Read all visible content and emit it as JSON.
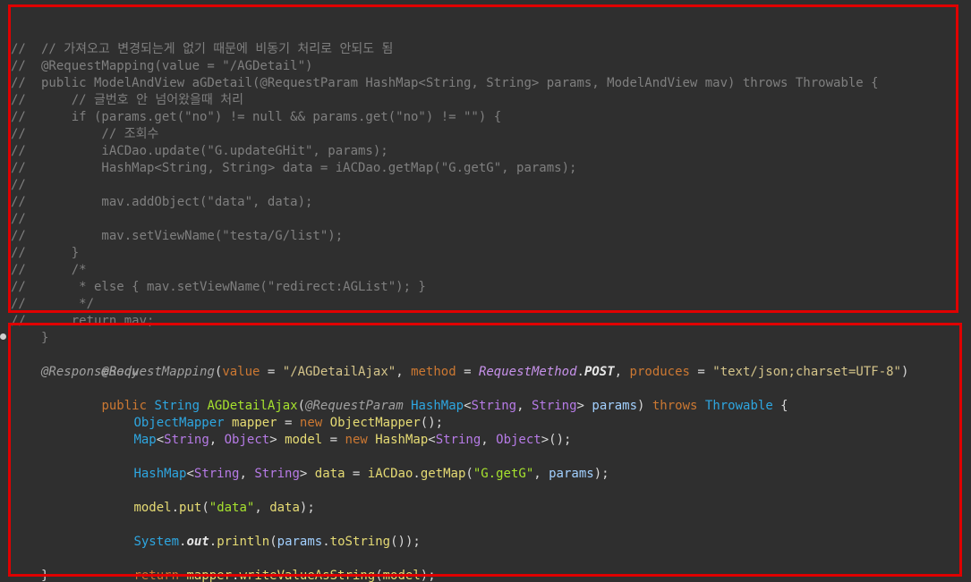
{
  "commented_block": {
    "lines": [
      "// 가져오고 변경되는게 없기 때문에 비동기 처리로 안되도 됨",
      "@RequestMapping(value = \"/AGDetail\")",
      "public ModelAndView aGDetail(@RequestParam HashMap<String, String> params, ModelAndView mav) throws Throwable {",
      "    // 글번호 안 넘어왔을때 처리",
      "    if (params.get(\"no\") != null && params.get(\"no\") != \"\") {",
      "        // 조회수",
      "        iACDao.update(\"G.updateGHit\", params);",
      "        HashMap<String, String> data = iACDao.getMap(\"G.getG\", params);",
      "",
      "        mav.addObject(\"data\", data);",
      "",
      "        mav.setViewName(\"testa/G/list\");",
      "    }",
      "    /*",
      "     * else { mav.setViewName(\"redirect:AGList\"); }",
      "     */",
      "    return mav;",
      "}"
    ],
    "margin_marks": [
      "",
      "//",
      "//",
      "//",
      "//",
      "//",
      "//",
      "//",
      "//",
      "//",
      "//",
      "//",
      "//",
      "//",
      "//",
      "//",
      "//",
      "//"
    ]
  },
  "active_block": {
    "line1": {
      "annotation": "@RequestMapping",
      "open": "(",
      "param1": "value",
      "eq1": " = ",
      "val1": "\"/AGDetailAjax\"",
      "comma1": ", ",
      "param2": "method",
      "eq2": " = ",
      "enum_type": "RequestMethod",
      "dot": ".",
      "enum_val": "POST",
      "comma2": ", ",
      "param3": "produces",
      "eq3": " = ",
      "val3": "\"text/json;charset=UTF-8\"",
      "close": ")"
    },
    "line2": "@ResponseBody",
    "line3": {
      "kw_public": "public",
      "sp1": " ",
      "type_string": "String",
      "sp2": " ",
      "method_name": "AGDetailAjax",
      "paren_open": "(",
      "param_annotation": "@RequestParam",
      "sp3": " ",
      "type_hashmap": "HashMap",
      "lt": "<",
      "type_s1": "String",
      "comma": ", ",
      "type_s2": "String",
      "gt": ">",
      "sp4": " ",
      "param_name": "params",
      "paren_close": ")",
      "sp5": " ",
      "kw_throws": "throws",
      "sp6": " ",
      "type_throwable": "Throwable",
      "brace": " {"
    },
    "line4": {
      "type": "ObjectMapper",
      "sp": " ",
      "var": "mapper",
      "eq": " = ",
      "kw_new": "new",
      "sp2": " ",
      "ctor": "ObjectMapper",
      "end": "();"
    },
    "line5": {
      "type_map": "Map",
      "lt": "<",
      "t1": "String",
      "comma": ", ",
      "t2": "Object",
      "gt": ">",
      "sp": " ",
      "var": "model",
      "eq": " = ",
      "kw_new": "new",
      "sp2": " ",
      "ctor": "HashMap",
      "lt2": "<",
      "t3": "String",
      "comma2": ", ",
      "t4": "Object",
      "gt2": ">",
      "end": "();"
    },
    "line7": {
      "type_map": "HashMap",
      "lt": "<",
      "t1": "String",
      "comma": ", ",
      "t2": "String",
      "gt": ">",
      "sp": " ",
      "var": "data",
      "eq": " = ",
      "obj": "iACDao",
      "dot": ".",
      "fn": "getMap",
      "open": "(",
      "str": "\"G.getG\"",
      "comma2": ", ",
      "arg": "params",
      "end": ");"
    },
    "line9": {
      "obj": "model",
      "dot": ".",
      "fn": "put",
      "open": "(",
      "str": "\"data\"",
      "comma": ", ",
      "arg": "data",
      "end": ");"
    },
    "line11": {
      "cls": "System",
      "dot": ".",
      "field": "out",
      "dot2": ".",
      "fn": "println",
      "open": "(",
      "arg": "params",
      "dot3": ".",
      "fn2": "toString",
      "end": "());"
    },
    "line13": {
      "kw_return": "return",
      "sp": " ",
      "obj": "mapper",
      "dot": ".",
      "fn": "writeValueAsString",
      "open": "(",
      "arg": "model",
      "end": ");"
    },
    "line14": "}"
  },
  "colors": {
    "background": "#2f2f2f",
    "highlight_frame": "#e00000",
    "comment": "#7f7f7f",
    "keyword": "#cc7832",
    "type": "#2ea6e0",
    "string": "#d4c48a"
  }
}
